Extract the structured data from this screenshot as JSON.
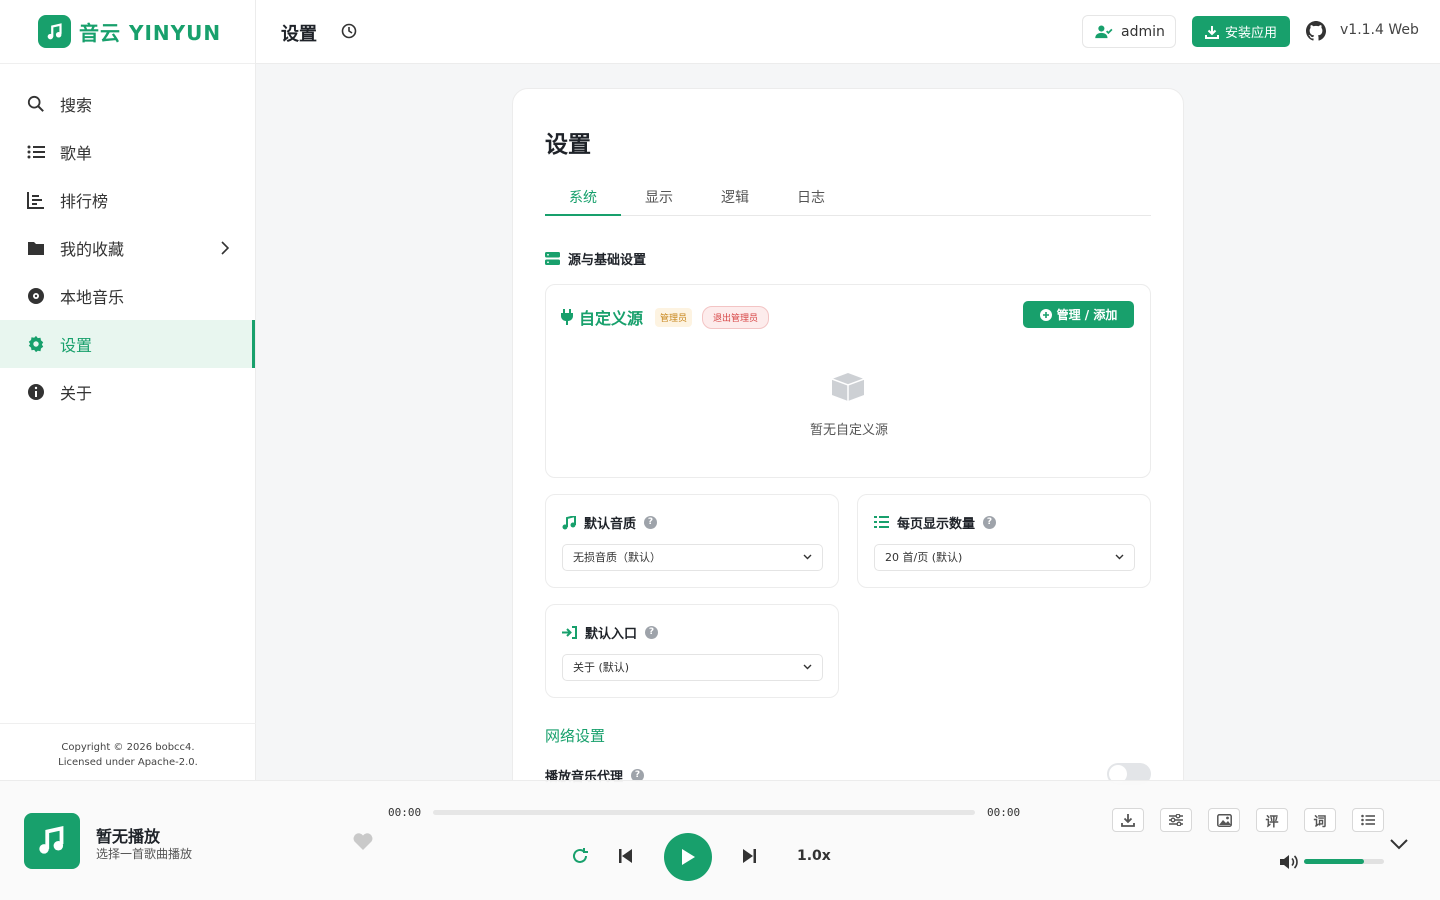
{
  "app": {
    "logo_text": "音云 YINYUN",
    "brand_color": "#18a06c"
  },
  "sidebar": {
    "items": [
      {
        "label": "搜索",
        "icon": "search-icon"
      },
      {
        "label": "歌单",
        "icon": "list-icon"
      },
      {
        "label": "排行榜",
        "icon": "chart-icon"
      },
      {
        "label": "我的收藏",
        "icon": "folder-icon"
      },
      {
        "label": "本地音乐",
        "icon": "disc-icon"
      },
      {
        "label": "设置",
        "icon": "gear-icon",
        "active": true
      },
      {
        "label": "关于",
        "icon": "info-icon"
      }
    ],
    "copyright_line1": "Copyright © 2026 bobcc4.",
    "copyright_line2": "Licensed under Apache-2.0."
  },
  "header": {
    "title": "设置",
    "user": "admin",
    "install_label": "安装应用",
    "version": "v1.1.4 Web"
  },
  "settings": {
    "title": "设置",
    "tabs": [
      "系统",
      "显示",
      "逻辑",
      "日志"
    ],
    "active_tab": "系统",
    "section_title": "源与基础设置",
    "custom_source": {
      "title": "自定义源",
      "badge_admin": "管理员",
      "badge_exit": "退出管理员",
      "manage_label": "管理 / 添加",
      "empty_text": "暂无自定义源"
    },
    "quality": {
      "label": "默认音质",
      "value": "无损音质（默认）"
    },
    "page_size": {
      "label": "每页显示数量",
      "value": "20 首/页 (默认)"
    },
    "entry": {
      "label": "默认入口",
      "value": "关于 (默认)"
    },
    "help_mark": "?",
    "network_title": "网络设置",
    "proxy_label": "播放音乐代理",
    "proxy_enabled": false
  },
  "player": {
    "title": "暂无播放",
    "subtitle": "选择一首歌曲播放",
    "time_current": "00:00",
    "time_total": "00:00",
    "progress": 0,
    "speed": "1.0x",
    "comment_label": "评",
    "lyrics_label": "词",
    "volume": 0.75
  }
}
